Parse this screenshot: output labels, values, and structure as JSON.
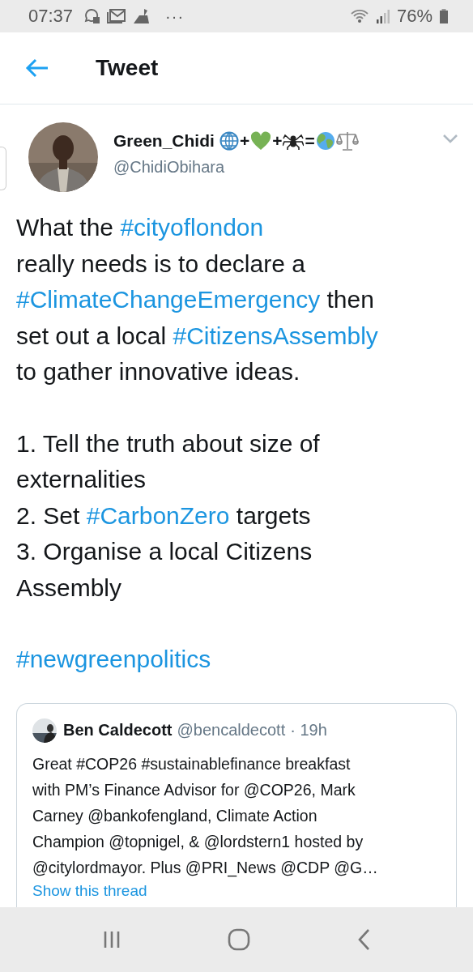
{
  "status_bar": {
    "time": "07:37",
    "more": "···",
    "battery": "76%"
  },
  "header": {
    "title": "Tweet"
  },
  "author": {
    "name": "Green_Chidi",
    "name_emoji": [
      {
        "kind": "globe"
      },
      {
        "kind": "symbol",
        "text": "+"
      },
      {
        "kind": "heart"
      },
      {
        "kind": "symbol",
        "text": "+"
      },
      {
        "kind": "spider"
      },
      {
        "kind": "symbol",
        "text": "="
      },
      {
        "kind": "earth"
      },
      {
        "kind": "scales"
      }
    ],
    "handle": "@ChidiObihara"
  },
  "body": [
    [
      [
        {
          "kind": "text",
          "text": "What the "
        },
        {
          "kind": "hashtag",
          "text": "#cityoflondon"
        }
      ],
      [
        {
          "kind": "text",
          "text": "really needs is to declare a"
        }
      ],
      [
        {
          "kind": "hashtag",
          "text": "#ClimateChangeEmergency"
        },
        {
          "kind": "text",
          "text": " then"
        }
      ],
      [
        {
          "kind": "text",
          "text": "set out a local "
        },
        {
          "kind": "hashtag",
          "text": "#CitizensAssembly"
        }
      ],
      [
        {
          "kind": "text",
          "text": "to gather innovative ideas."
        }
      ]
    ],
    [
      [
        {
          "kind": "text",
          "text": "1. Tell the truth about size of"
        }
      ],
      [
        {
          "kind": "text",
          "text": "externalities"
        }
      ],
      [
        {
          "kind": "text",
          "text": "2. Set "
        },
        {
          "kind": "hashtag",
          "text": "#CarbonZero"
        },
        {
          "kind": "text",
          "text": " targets"
        }
      ],
      [
        {
          "kind": "text",
          "text": "3. Organise a local Citizens"
        }
      ],
      [
        {
          "kind": "text",
          "text": "Assembly"
        }
      ]
    ],
    [
      [
        {
          "kind": "hashtag",
          "text": "#newgreenpolitics"
        }
      ]
    ]
  ],
  "quoted": {
    "name": "Ben Caldecott",
    "handle": "@bencaldecott",
    "time": "· 19h",
    "lines": [
      "Great #COP26 #sustainablefinance breakfast",
      "with PM’s Finance Advisor for @COP26, Mark",
      "Carney @bankofengland, Climate Action",
      "Champion @topnigel, & @lordstern1 hosted by",
      "@citylordmayor. Plus @PRI_News @CDP @G…"
    ],
    "link": "Show this thread"
  }
}
